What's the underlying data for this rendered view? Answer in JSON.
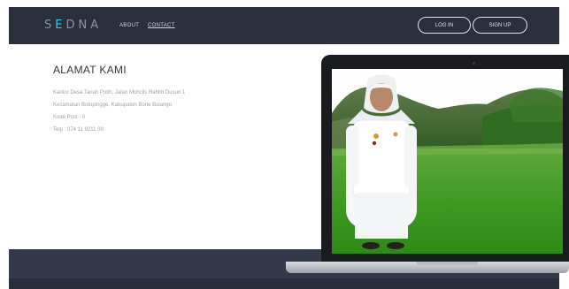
{
  "header": {
    "logo_prefix": "S",
    "logo_accent": "E",
    "logo_suffix": "DNA",
    "nav": {
      "about": "ABOUT",
      "contact": "CONTACT"
    },
    "login_label": "LOG IN",
    "signup_label": "SIGN UP"
  },
  "contact": {
    "heading": "ALAMAT KAMI",
    "lines": [
      "Kantor Desa Tanah Putih, Jalan Muhclis Rahim Dusun 1",
      "Kecamatan Botupingge, Kabupaten Bone Bolango",
      "Kode Post : 0",
      "Telp : 074 11 9211 00"
    ]
  },
  "colors": {
    "navbar": "#2a2f3b",
    "accent": "#3ec6d8",
    "heading": "#333840",
    "body_text": "#9aa0a9"
  },
  "icons": {
    "screen_image": "official-portrait-landscape-photo"
  }
}
